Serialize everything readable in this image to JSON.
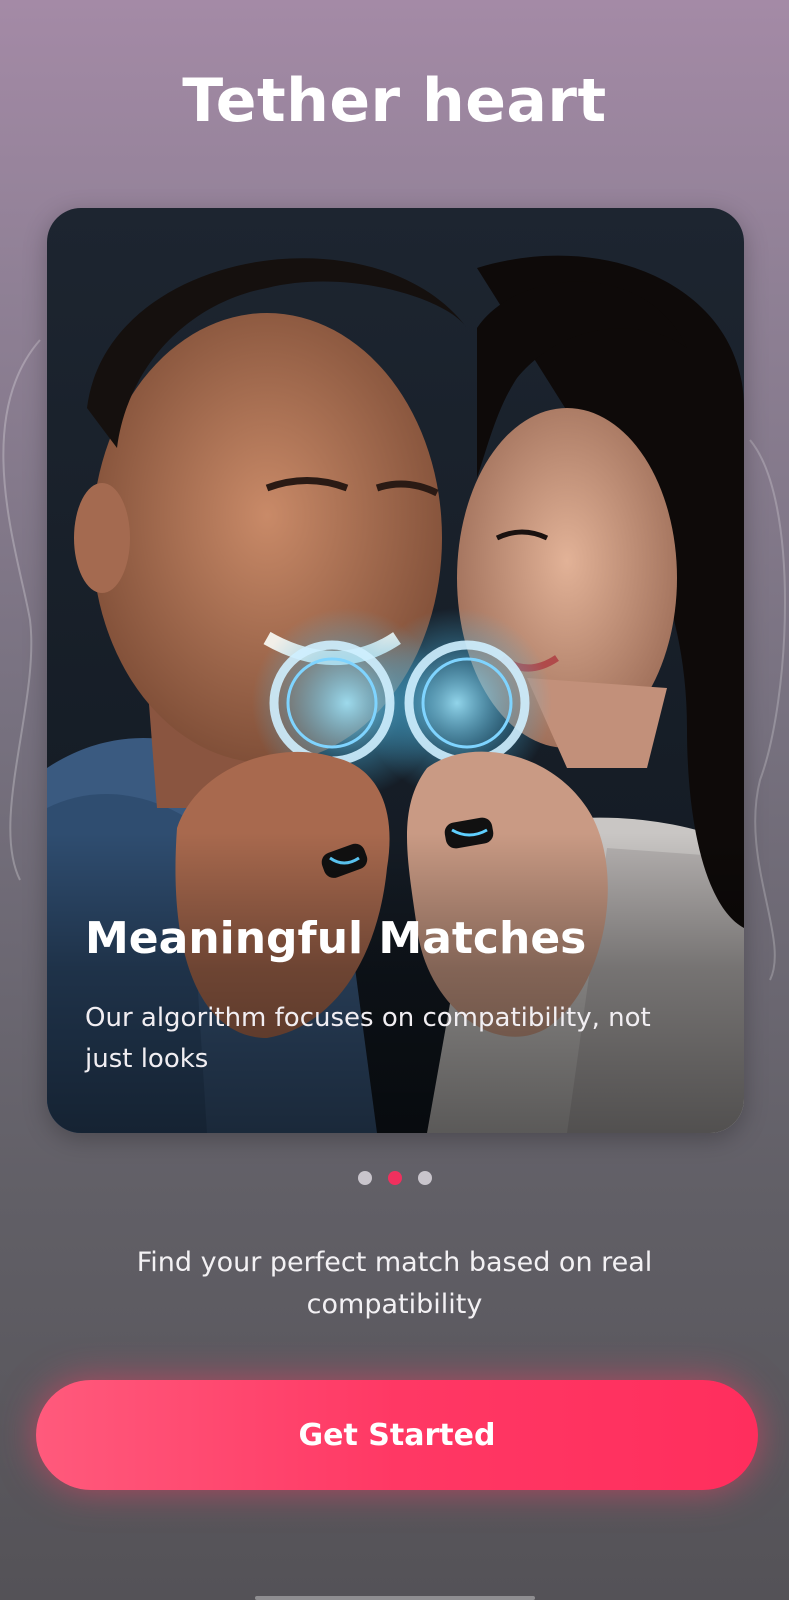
{
  "app": {
    "title": "Tether heart"
  },
  "slide": {
    "heading": "Meaningful Matches",
    "body": "Our algorithm focuses on compatibility, not just looks",
    "image": "couple-holding-glowing-rings-photo"
  },
  "pagination": {
    "count": 3,
    "active_index": 1
  },
  "tagline": "Find your perfect match based on real compatibility",
  "cta": {
    "label": "Get Started"
  },
  "colors": {
    "accent": "#ff3864",
    "active_dot": "#f0305e",
    "inactive_dot": "#c9c5cc"
  }
}
